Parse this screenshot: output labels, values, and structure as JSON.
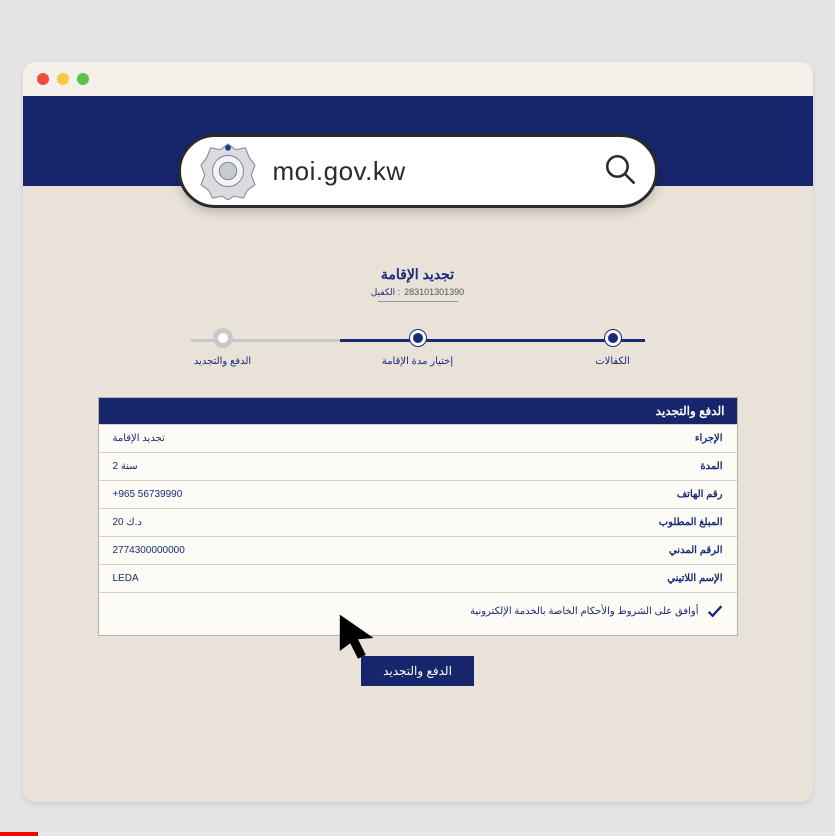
{
  "url": "moi.gov.kw",
  "page_title": "تجديد الإقامة",
  "sponsor_label": "الكفيل :",
  "sponsor_id": "283101301390",
  "steps": [
    {
      "label": "الكفالات",
      "state": "done"
    },
    {
      "label": "إختيار مدة الإقامة",
      "state": "done"
    },
    {
      "label": "الدفع والتجديد",
      "state": "current"
    }
  ],
  "panel_title": "الدفع والتجديد",
  "rows": [
    {
      "label": "الإجراء",
      "value": "تجديد الإقامة"
    },
    {
      "label": "المدة",
      "value": "2 سنة"
    },
    {
      "label": "رقم الهاتف",
      "value": "+965 56739990"
    },
    {
      "label": "المبلغ المطلوب",
      "value": "20 د.ك"
    },
    {
      "label": "الرقم المدني",
      "value": "2774300000000"
    },
    {
      "label": "الإسم اللاتيني",
      "value": "LEDA"
    }
  ],
  "terms_text": "أوافق على الشروط والأحكام الخاصة بالخدمة الإلكترونية",
  "submit_label": "الدفع والتجديد",
  "colors": {
    "accent": "#17256d"
  }
}
